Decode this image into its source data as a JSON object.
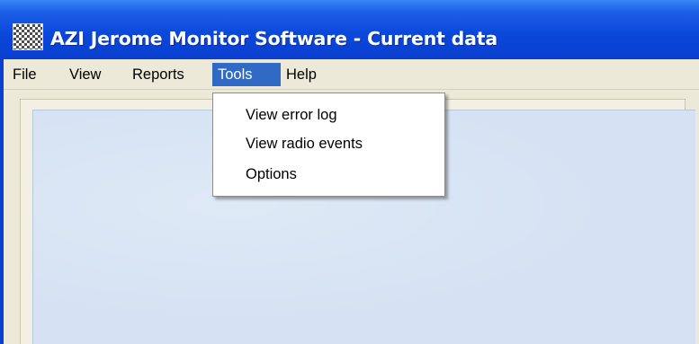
{
  "window": {
    "title": "AZI Jerome Monitor Software - Current data",
    "icon": "checkered-app-icon"
  },
  "menubar": {
    "items": [
      {
        "label": "File",
        "active": false
      },
      {
        "label": "View",
        "active": false
      },
      {
        "label": "Reports",
        "active": false
      },
      {
        "label": "Tools",
        "active": true
      },
      {
        "label": "Help",
        "active": false
      }
    ]
  },
  "tools_menu": {
    "items": [
      {
        "label": "View error log"
      },
      {
        "label": "View radio events"
      },
      {
        "label": "Options"
      }
    ]
  },
  "colors": {
    "titlebar": "#0b48db",
    "menu_background": "#ece9d8",
    "menu_highlight": "#316ac5",
    "content_background": "#d4e2f3"
  }
}
